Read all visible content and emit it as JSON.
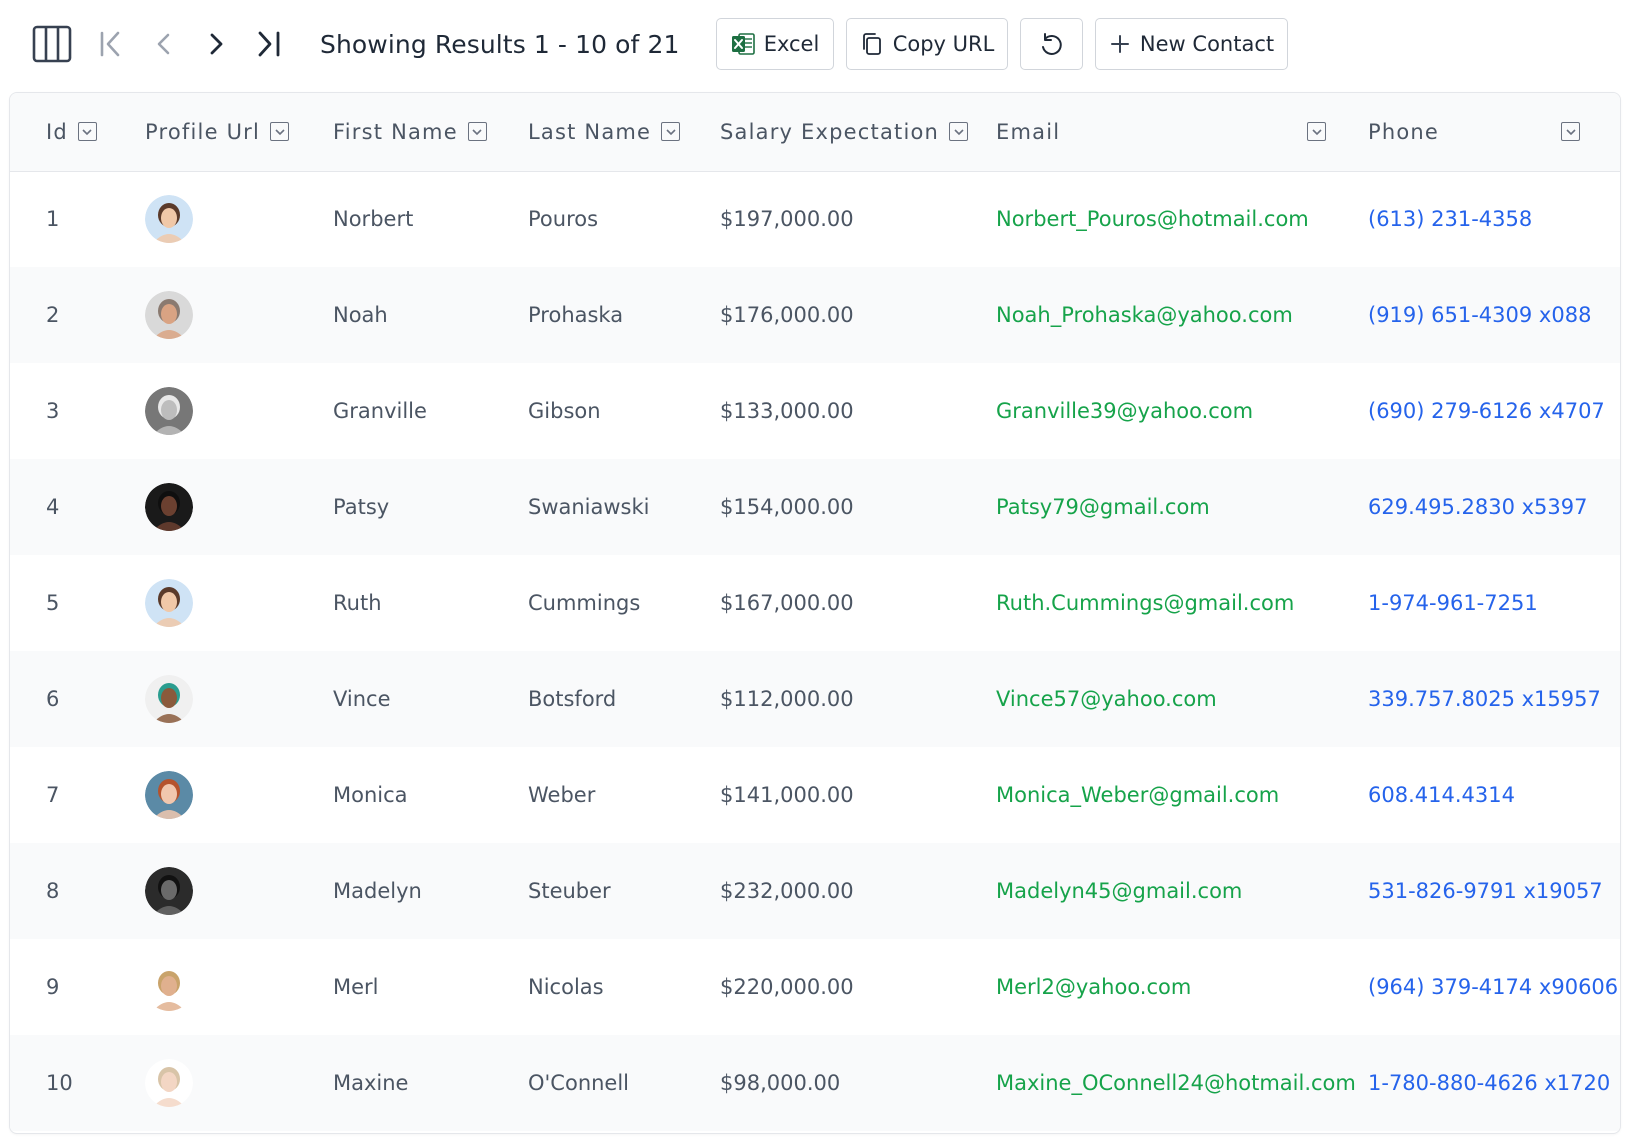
{
  "toolbar": {
    "results_text": "Showing Results 1 - 10 of 21",
    "excel_label": "Excel",
    "copy_url_label": "Copy URL",
    "new_contact_label": "New Contact",
    "excel_color": "#1d6f42"
  },
  "columns": [
    {
      "label": "Id"
    },
    {
      "label": "Profile Url"
    },
    {
      "label": "First Name"
    },
    {
      "label": "Last Name"
    },
    {
      "label": "Salary Expectation"
    },
    {
      "label": "Email"
    },
    {
      "label": "Phone"
    }
  ],
  "colors": {
    "email": "#16a34a",
    "phone": "#2563eb",
    "row_alt": "#f9fafb"
  },
  "rows": [
    {
      "id": "1",
      "first": "Norbert",
      "last": "Pouros",
      "salary": "$197,000.00",
      "email": "Norbert_Pouros@hotmail.com",
      "phone": "(613) 231-4358",
      "avatar": {
        "bg": "#cfe3f5",
        "skin": "#f0c8a8",
        "hair": "#5a3a2a"
      }
    },
    {
      "id": "2",
      "first": "Noah",
      "last": "Prohaska",
      "salary": "$176,000.00",
      "email": "Noah_Prohaska@yahoo.com",
      "phone": "(919) 651-4309 x088",
      "avatar": {
        "bg": "#d9d9d9",
        "skin": "#d9a383",
        "hair": "#8a7a70"
      }
    },
    {
      "id": "3",
      "first": "Granville",
      "last": "Gibson",
      "salary": "$133,000.00",
      "email": "Granville39@yahoo.com",
      "phone": "(690) 279-6126 x4707",
      "avatar": {
        "bg": "#777777",
        "skin": "#bdbdbd",
        "hair": "#e8e8e8"
      }
    },
    {
      "id": "4",
      "first": "Patsy",
      "last": "Swaniawski",
      "salary": "$154,000.00",
      "email": "Patsy79@gmail.com",
      "phone": "629.495.2830 x5397",
      "avatar": {
        "bg": "#1a1a1a",
        "skin": "#6b4030",
        "hair": "#0f0f0f"
      }
    },
    {
      "id": "5",
      "first": "Ruth",
      "last": "Cummings",
      "salary": "$167,000.00",
      "email": "Ruth.Cummings@gmail.com",
      "phone": "1-974-961-7251",
      "avatar": {
        "bg": "#cfe3f5",
        "skin": "#f0c8a8",
        "hair": "#5a3a2a"
      }
    },
    {
      "id": "6",
      "first": "Vince",
      "last": "Botsford",
      "salary": "$112,000.00",
      "email": "Vince57@yahoo.com",
      "phone": "339.757.8025 x15957",
      "avatar": {
        "bg": "#f0f0f0",
        "skin": "#8a5a3c",
        "hair": "#2a9d8f"
      }
    },
    {
      "id": "7",
      "first": "Monica",
      "last": "Weber",
      "salary": "$141,000.00",
      "email": "Monica_Weber@gmail.com",
      "phone": "608.414.4314",
      "avatar": {
        "bg": "#5b8aa6",
        "skin": "#f1c7ae",
        "hair": "#b5532d"
      }
    },
    {
      "id": "8",
      "first": "Madelyn",
      "last": "Steuber",
      "salary": "$232,000.00",
      "email": "Madelyn45@gmail.com",
      "phone": "531-826-9791 x19057",
      "avatar": {
        "bg": "#2b2b2b",
        "skin": "#6a6a6a",
        "hair": "#111111"
      }
    },
    {
      "id": "9",
      "first": "Merl",
      "last": "Nicolas",
      "salary": "$220,000.00",
      "email": "Merl2@yahoo.com",
      "phone": "(964) 379-4174 x90606",
      "avatar": {
        "bg": "#ffffff",
        "skin": "#e0b08e",
        "hair": "#c9a36b"
      }
    },
    {
      "id": "10",
      "first": "Maxine",
      "last": "O'Connell",
      "salary": "$98,000.00",
      "email": "Maxine_OConnell24@hotmail.com",
      "phone": "1-780-880-4626 x1720",
      "avatar": {
        "bg": "#ffffff",
        "skin": "#f3d6c4",
        "hair": "#d8c4a8"
      }
    }
  ]
}
